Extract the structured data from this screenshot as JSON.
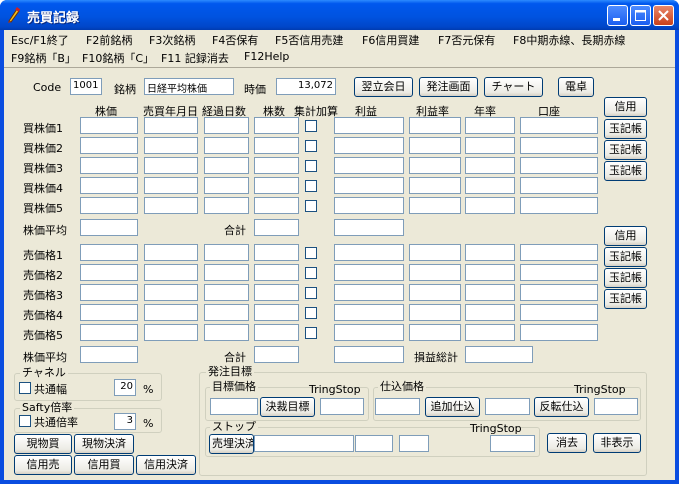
{
  "window": {
    "title": "売買記録"
  },
  "menu": {
    "row1": [
      "Esc/F1終了",
      "F2前銘柄",
      "F3次銘柄",
      "F4否保有",
      "F5否信用売建",
      "F6信用買建",
      "F7否元保有",
      "F8中期赤線、長期赤線"
    ],
    "row2": [
      "F9銘柄「B」",
      "F10銘柄「C」",
      "F11 記録消去",
      "F12Help"
    ]
  },
  "header": {
    "code_label": "Code",
    "code_value": "1001",
    "meigara_label": "銘柄",
    "meigara_value": "日経平均株価",
    "jikan_label": "時価",
    "jikan_value": "13,072",
    "btn_next_day": "翌立会日",
    "btn_order_screen": "発注画面",
    "btn_chart": "チャート",
    "btn_calc": "電卓"
  },
  "columns": {
    "price": "株価",
    "date": "売買年月日",
    "days": "経過日数",
    "shares": "株数",
    "total": "集計加算",
    "profit": "利益",
    "rate": "利益率",
    "annual": "年率",
    "account": "口座"
  },
  "buy": {
    "rows": [
      "買株価1",
      "買株価2",
      "買株価3",
      "買株価4",
      "買株価5"
    ],
    "avg_label": "株価平均",
    "sum_label": "合計",
    "side_buttons": [
      "信用",
      "玉記帳",
      "玉記帳",
      "玉記帳"
    ]
  },
  "sell": {
    "rows": [
      "売価格1",
      "売価格2",
      "売価格3",
      "売価格4",
      "売価格5"
    ],
    "avg_label": "株価平均",
    "sum_label": "合計",
    "total_pl_label": "損益総計",
    "side_buttons": [
      "信用",
      "玉記帳",
      "玉記帳",
      "玉記帳"
    ]
  },
  "channel": {
    "title": "チャネル",
    "checkbox_label": "共通幅",
    "value": "20",
    "unit": "%"
  },
  "safety": {
    "title": "Safty倍率",
    "checkbox_label": "共通倍率",
    "value": "3",
    "unit": "%"
  },
  "trade_buttons": {
    "spot_buy": "現物買",
    "spot_settle": "現物決済",
    "credit_sell": "信用売",
    "credit_buy": "信用買",
    "credit_settle": "信用決済"
  },
  "order": {
    "title": "発注目標",
    "target": {
      "title": "目標価格",
      "tring_label": "TringStop",
      "button": "決裁目標"
    },
    "entry": {
      "title": "仕込価格",
      "tring_label": "TringStop",
      "button_add": "追加仕込",
      "button_reverse": "反転仕込"
    },
    "stop": {
      "title": "ストップ",
      "tring_label": "TringStop",
      "button": "売埋決済"
    },
    "btn_clear": "消去",
    "btn_hide": "非表示"
  }
}
